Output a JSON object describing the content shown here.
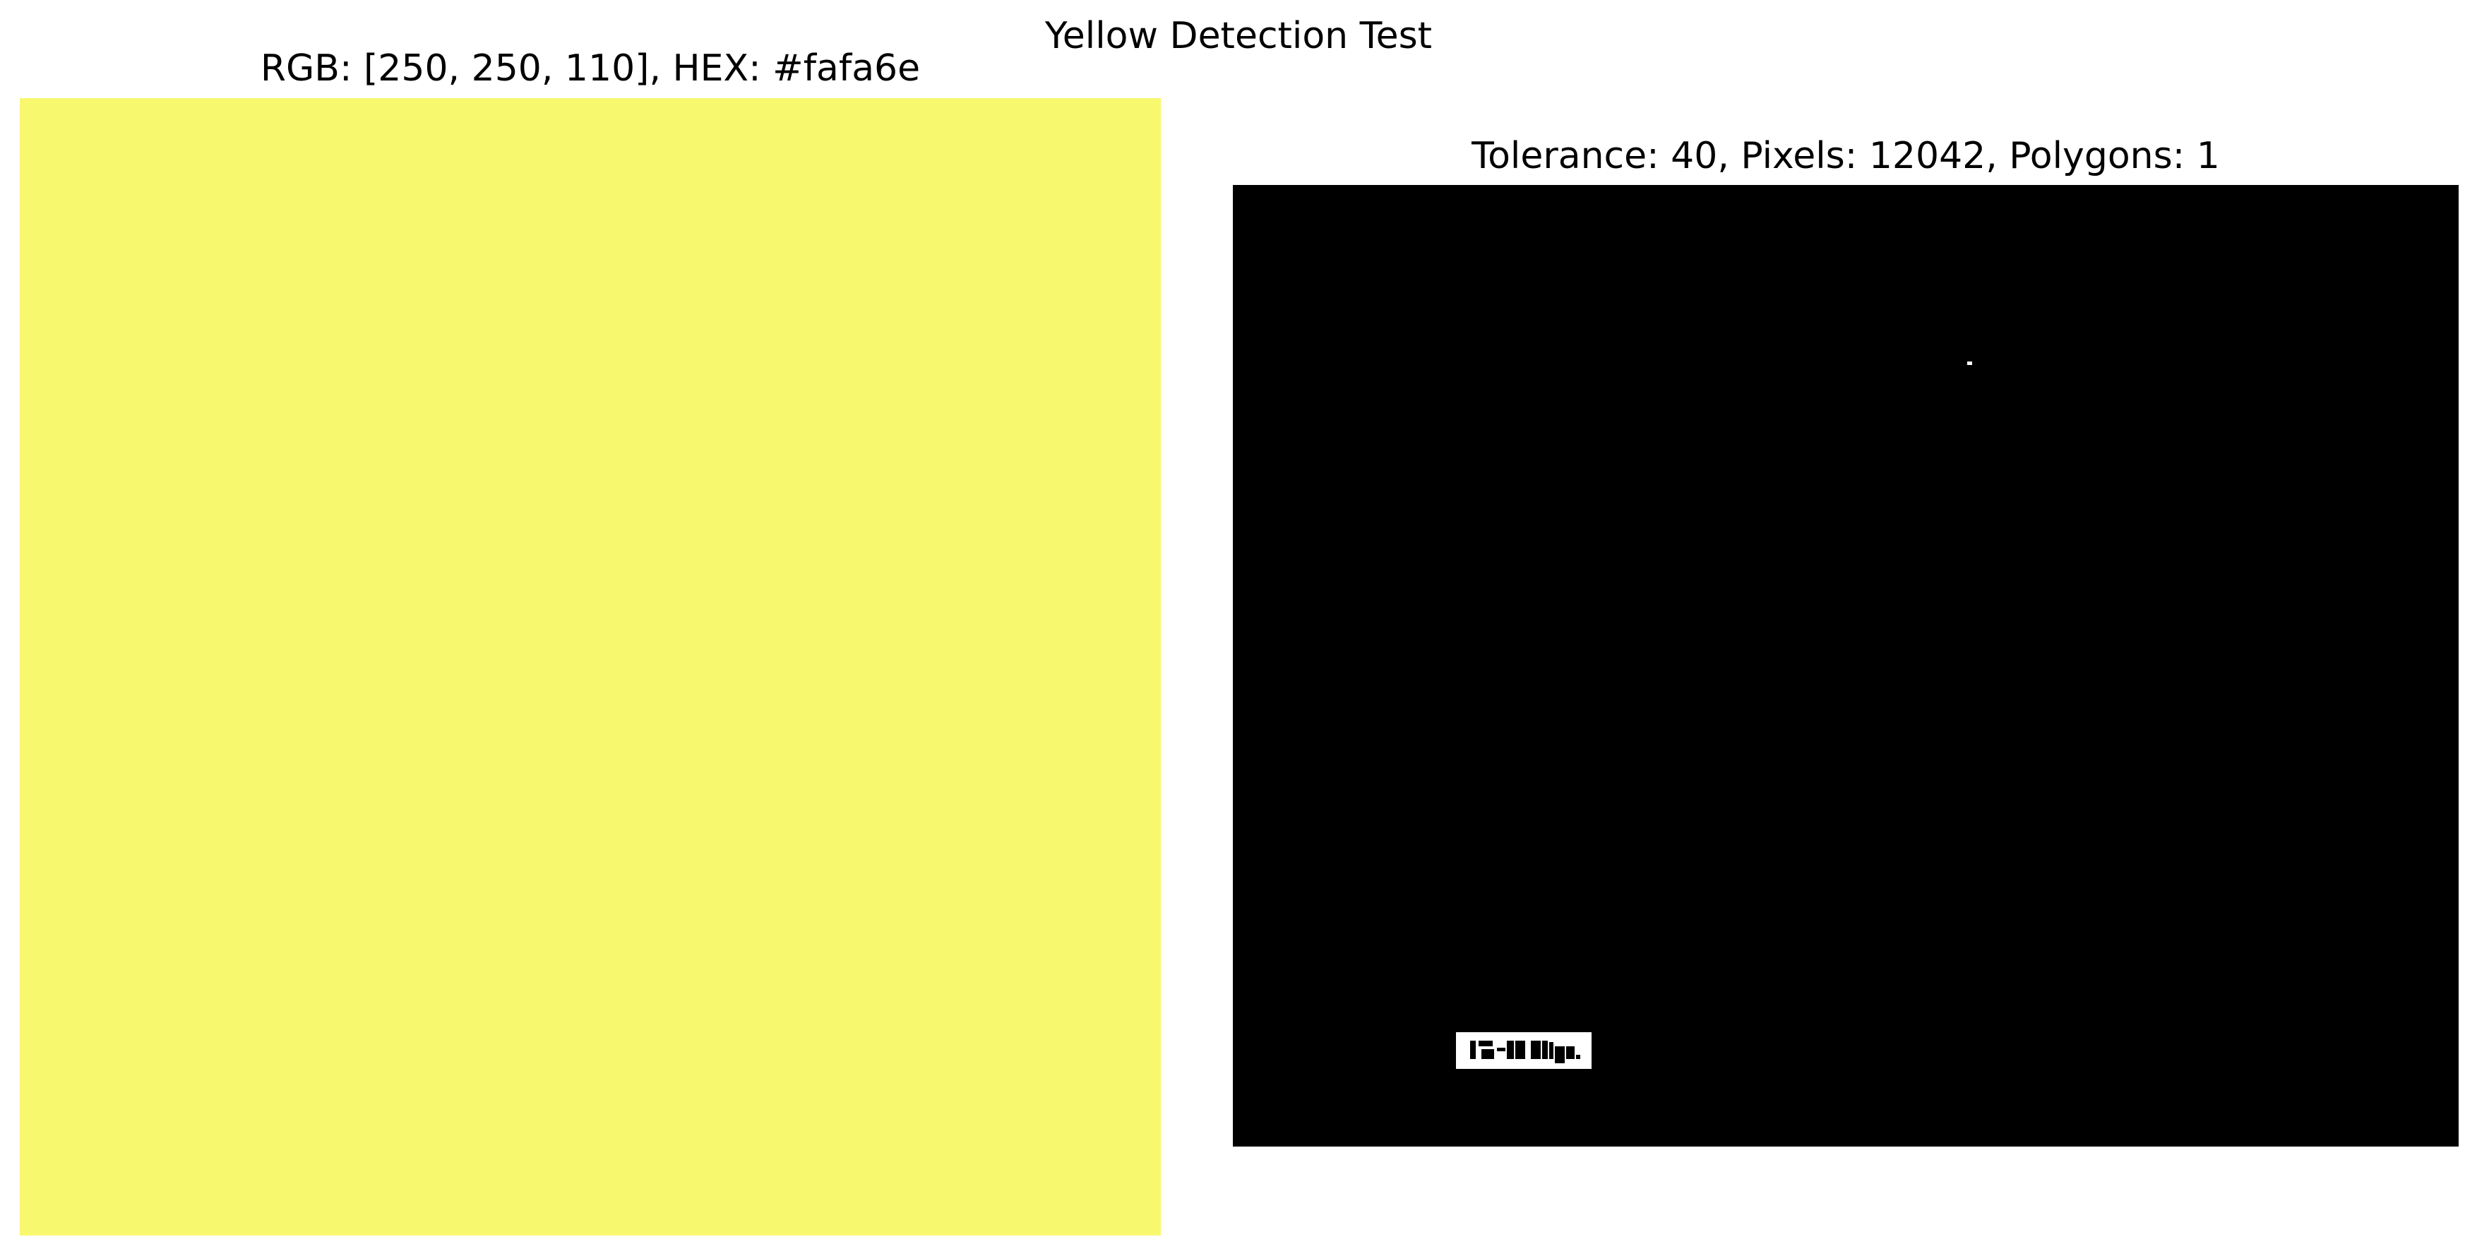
{
  "figure": {
    "suptitle": "Yellow Detection Test"
  },
  "left_panel": {
    "title": "RGB: [250, 250, 110], HEX: #fafa6e",
    "swatch_color": "#f8f86f"
  },
  "right_panel": {
    "title": "Tolerance: 40, Pixels: 12042, Polygons: 1",
    "mask_background": "#000000",
    "mask_foreground": "#ffffff"
  }
}
